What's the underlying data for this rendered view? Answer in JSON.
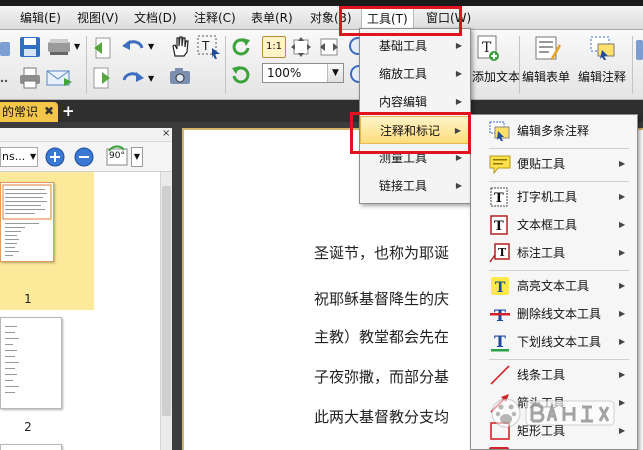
{
  "menubar": {
    "items": [
      {
        "label": "编辑(E)"
      },
      {
        "label": "视图(V)"
      },
      {
        "label": "文档(D)"
      },
      {
        "label": "注释(C)"
      },
      {
        "label": "表单(R)"
      },
      {
        "label": "对象(B)"
      },
      {
        "label": "工具(T)",
        "active": true
      },
      {
        "label": "窗口(W)"
      }
    ]
  },
  "toolbar": {
    "zoom_value": "100%",
    "fit_ratio_label": "1:1",
    "rotate_label": "90°",
    "add_text_label": "添加文本",
    "edit_form_label": "编辑表单",
    "edit_annotation_label": "编辑注释"
  },
  "tabs": {
    "document_tab": "的常识",
    "add_tab": "+"
  },
  "thumbnail_panel": {
    "close_glyph": "×",
    "combo_value": "ns...",
    "pages": [
      {
        "number": "1"
      },
      {
        "number": "2"
      }
    ]
  },
  "document": {
    "lines": [
      "圣诞节，也称为耶诞",
      "祝耶稣基督降生的庆",
      "主教）教堂都会先在",
      "子夜弥撒，而部分基",
      "此两大基督教分支均"
    ]
  },
  "tools_menu": {
    "items": [
      {
        "label": "基础工具"
      },
      {
        "label": "缩放工具"
      },
      {
        "label": "内容编辑"
      },
      {
        "label": "注释和标记",
        "highlighted": true
      },
      {
        "label": "测量工具"
      },
      {
        "label": "链接工具"
      }
    ]
  },
  "annotation_submenu": {
    "items": [
      {
        "label": "编辑多条注释",
        "icon": "edit-multiple-annotations-icon"
      },
      {
        "label": "便贴工具",
        "icon": "sticky-note-icon"
      },
      {
        "label": "打字机工具",
        "icon": "typewriter-icon"
      },
      {
        "label": "文本框工具",
        "icon": "textbox-icon"
      },
      {
        "label": "标注工具",
        "icon": "callout-icon"
      },
      {
        "label": "高亮文本工具",
        "icon": "highlight-text-icon"
      },
      {
        "label": "删除线文本工具",
        "icon": "strikeout-text-icon"
      },
      {
        "label": "下划线文本工具",
        "icon": "underline-text-icon"
      },
      {
        "label": "线条工具",
        "icon": "line-tool-icon"
      },
      {
        "label": "箭头工具",
        "icon": "arrow-tool-icon"
      },
      {
        "label": "矩形工具",
        "icon": "rectangle-tool-icon"
      }
    ]
  },
  "colors": {
    "highlight_red": "#e0141e",
    "tab_yellow": "#f3c54b",
    "menu_highlight": "#fddc7d"
  }
}
